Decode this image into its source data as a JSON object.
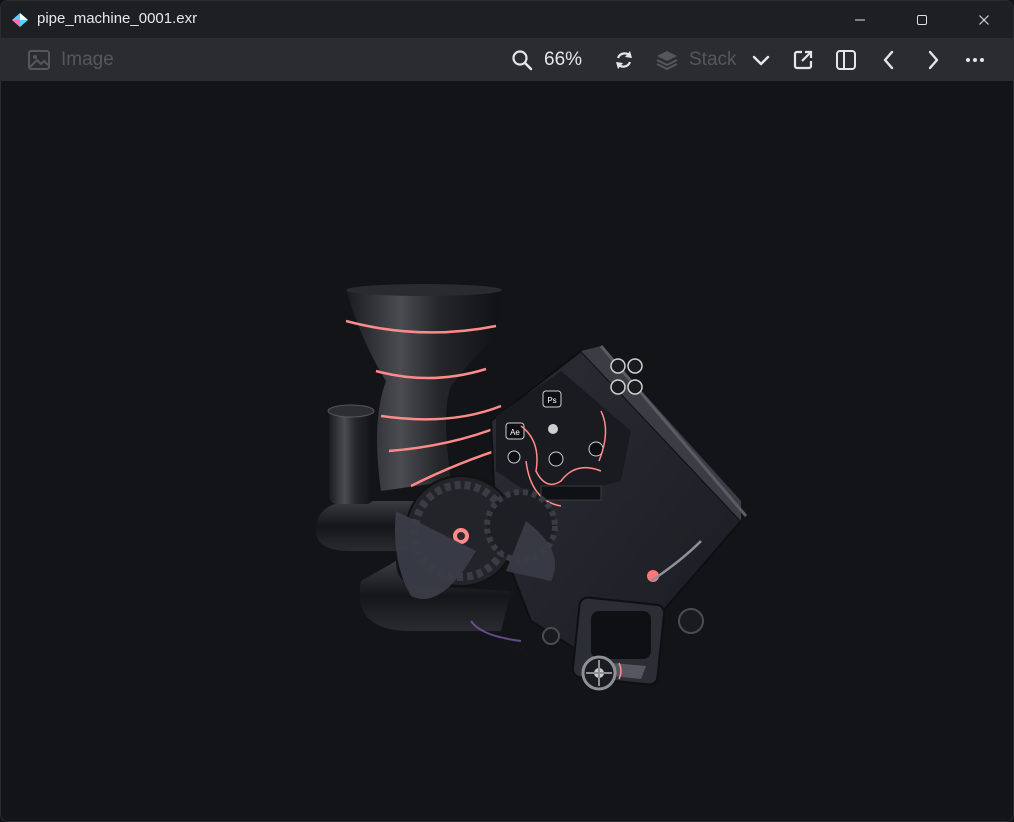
{
  "window": {
    "title": "pipe_machine_0001.exr",
    "minimize_icon": "minimize-icon",
    "maximize_icon": "maximize-icon",
    "close_icon": "close-icon"
  },
  "toolbar": {
    "image_label": "Image",
    "image_icon": "image-icon",
    "zoom_level": "66%",
    "zoom_icon": "zoom-icon",
    "rotate_icon": "rotate-icon",
    "stack_label": "Stack",
    "stack_icon": "layers-icon",
    "stack_chevron_icon": "chevron-down-icon",
    "open_external_icon": "open-external-icon",
    "panel_icon": "panel-toggle-icon",
    "prev_icon": "chevron-left-icon",
    "next_icon": "chevron-right-icon",
    "more_icon": "more-icon"
  },
  "canvas": {
    "image_subject": "3D render of a dark pipe machine with software logo badges"
  },
  "colors": {
    "title_bar": "#1d1f23",
    "toolbar": "#2a2c31",
    "canvas": "#121418",
    "accent_pink": "#ff8a8a"
  }
}
